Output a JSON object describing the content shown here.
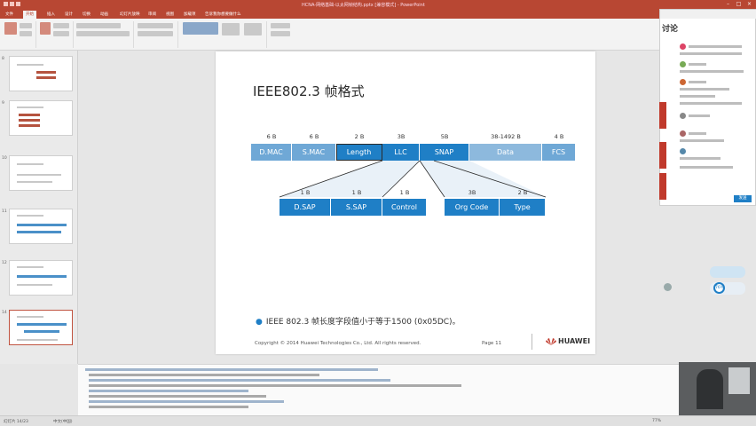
{
  "window": {
    "title": "HCNA-网络基础-以太网帧结构.pptx [兼容模式] - PowerPoint"
  },
  "ribbon": {
    "tabs": [
      "文件",
      "开始",
      "插入",
      "设计",
      "切换",
      "动画",
      "幻灯片放映",
      "审阅",
      "视图",
      "加载项",
      "告诉我你想要做什么"
    ],
    "active_tab": "开始"
  },
  "thumbnails": {
    "numbers": [
      "8",
      "9",
      "10",
      "11",
      "12",
      "13",
      "14"
    ],
    "selected": "14"
  },
  "slide": {
    "title": "IEEE802.3 帧格式",
    "frame_top": [
      {
        "size": "6 B",
        "label": "D.MAC",
        "style": "light"
      },
      {
        "size": "6 B",
        "label": "S.MAC",
        "style": "light"
      },
      {
        "size": "2 B",
        "label": "Length",
        "style": "mid"
      },
      {
        "size": "3B",
        "label": "LLC",
        "style": "mid"
      },
      {
        "size": "5B",
        "label": "SNAP",
        "style": "mid"
      },
      {
        "size": "38-1492 B",
        "label": "Data",
        "style": "grey"
      },
      {
        "size": "4 B",
        "label": "FCS",
        "style": "light"
      }
    ],
    "llc_fields": [
      {
        "size": "1 B",
        "label": "D.SAP"
      },
      {
        "size": "1 B",
        "label": "S.SAP"
      },
      {
        "size": "1 B",
        "label": "Control"
      }
    ],
    "snap_fields": [
      {
        "size": "3B",
        "label": "Org Code"
      },
      {
        "size": "2 B",
        "label": "Type"
      }
    ],
    "bullet": "IEEE 802.3 帧长度字段值小于等于1500 (0x05DC)。",
    "copyright": "Copyright © 2014 Huawei Technologies Co., Ltd. All rights reserved.",
    "page": "Page 11",
    "logo": "HUAWEI"
  },
  "chat": {
    "title": "讨论",
    "send_label": "发送"
  },
  "status": {
    "slide_info": "幻灯片 14/23",
    "language": "中文(中国)",
    "zoom": "77%"
  },
  "widgets": {
    "progress_label": "76%"
  },
  "colors": {
    "accent": "#b84733",
    "cell_light": "#6fa8d6",
    "cell_mid": "#1f7fc6",
    "cell_grey": "#8db9dd"
  }
}
